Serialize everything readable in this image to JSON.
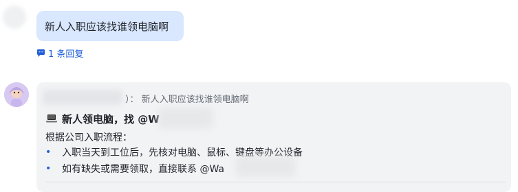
{
  "question_message": {
    "text": "新人入职应该找谁领电脑啊",
    "reply_count_label": "1 条回复"
  },
  "answer_message": {
    "quote_text": "）： 新人入职应该找谁领电脑啊",
    "title_text": "新人领电脑，找 @W",
    "intro_text": "根据公司入职流程：",
    "steps": [
      {
        "bullet": "•",
        "text": "入职当天到工位后，先核对电脑、鼠标、键盘等办公设备"
      },
      {
        "bullet": "•",
        "text": "如有缺失或需要领取，直接联系 @Wa"
      }
    ]
  },
  "colors": {
    "bubble_bg": "#d9e7ff",
    "card_bg": "#f2f3f5",
    "link_blue": "#1f5ed6"
  },
  "icons": [
    "chat-bubble-icon",
    "laptop-icon",
    "avatar"
  ]
}
